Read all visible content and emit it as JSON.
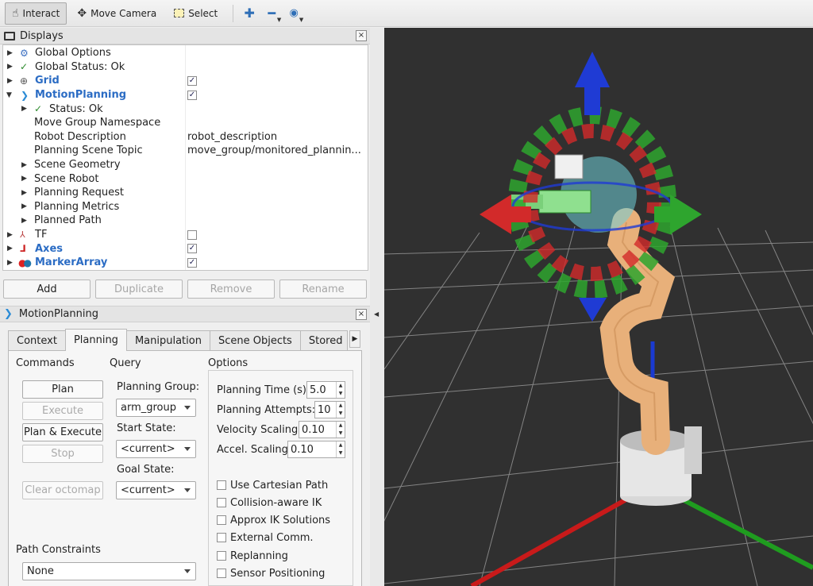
{
  "toolbar": {
    "interact_label": "Interact",
    "move_camera_label": "Move Camera",
    "select_label": "Select"
  },
  "displays": {
    "title": "Displays",
    "close_glyph": "×",
    "rows": [
      {
        "label": "Global Options"
      },
      {
        "label": "Global Status: Ok"
      },
      {
        "label": "Grid",
        "checked": true
      },
      {
        "label": "MotionPlanning",
        "checked": true
      },
      {
        "label": "Status: Ok"
      },
      {
        "label": "Move Group Namespace",
        "value": ""
      },
      {
        "label": "Robot Description",
        "value": "robot_description"
      },
      {
        "label": "Planning Scene Topic",
        "value": "move_group/monitored_plannin..."
      },
      {
        "label": "Scene Geometry"
      },
      {
        "label": "Scene Robot"
      },
      {
        "label": "Planning Request"
      },
      {
        "label": "Planning Metrics"
      },
      {
        "label": "Planned Path"
      },
      {
        "label": "TF",
        "checked": false
      },
      {
        "label": "Axes",
        "checked": true
      },
      {
        "label": "MarkerArray",
        "checked": true
      }
    ],
    "buttons": {
      "add": "Add",
      "duplicate": "Duplicate",
      "remove": "Remove",
      "rename": "Rename"
    }
  },
  "motion_planning": {
    "title": "MotionPlanning",
    "tabs": [
      "Context",
      "Planning",
      "Manipulation",
      "Scene Objects",
      "Stored"
    ],
    "active_tab": "Planning",
    "commands": {
      "heading": "Commands",
      "plan": "Plan",
      "execute": "Execute",
      "plan_execute": "Plan & Execute",
      "stop": "Stop",
      "clear_octomap": "Clear octomap"
    },
    "query": {
      "heading": "Query",
      "planning_group_label": "Planning Group:",
      "planning_group_value": "arm_group",
      "start_state_label": "Start State:",
      "start_state_value": "<current>",
      "goal_state_label": "Goal State:",
      "goal_state_value": "<current>"
    },
    "options": {
      "heading": "Options",
      "planning_time_label": "Planning Time (s):",
      "planning_time_value": "5.0",
      "planning_attempts_label": "Planning Attempts:",
      "planning_attempts_value": "10",
      "velocity_scaling_label": "Velocity Scaling:",
      "velocity_scaling_value": "0.10",
      "accel_scaling_label": "Accel. Scaling:",
      "accel_scaling_value": "0.10",
      "checkboxes": [
        "Use Cartesian Path",
        "Collision-aware IK",
        "Approx IK Solutions",
        "External Comm.",
        "Replanning",
        "Sensor Positioning"
      ]
    },
    "path_constraints": {
      "label": "Path Constraints",
      "value": "None"
    }
  },
  "colors": {
    "viewport_bg": "#303030",
    "grid": "#a0a0a0",
    "arm": "#e8b07a",
    "link_blue": "#2b6cc4"
  }
}
